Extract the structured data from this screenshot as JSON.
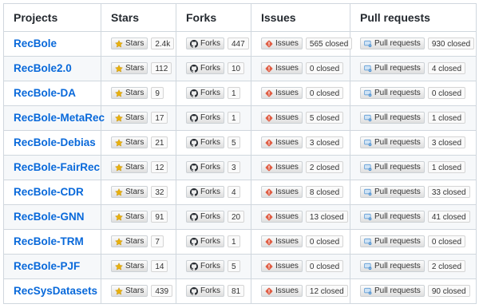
{
  "headers": {
    "projects": "Projects",
    "stars": "Stars",
    "forks": "Forks",
    "issues": "Issues",
    "pull_requests": "Pull requests"
  },
  "badge_labels": {
    "stars": "Stars",
    "forks": "Forks",
    "issues": "Issues",
    "pull_requests": "Pull requests"
  },
  "icons": {
    "stars": "star-icon",
    "forks": "github-octocat-icon",
    "issues": "issue-diamond-icon",
    "pull_requests": "pull-request-icon"
  },
  "colors": {
    "link": "#0969da",
    "star": "#e8b10e",
    "issue": "#e05d44",
    "pull_request": "#4a8fd0"
  },
  "rows": [
    {
      "project": "RecBole",
      "stars": "2.4k",
      "forks": "447",
      "issues": "565 closed",
      "pulls": "930 closed"
    },
    {
      "project": "RecBole2.0",
      "stars": "112",
      "forks": "10",
      "issues": "0 closed",
      "pulls": "4 closed"
    },
    {
      "project": "RecBole-DA",
      "stars": "9",
      "forks": "1",
      "issues": "0 closed",
      "pulls": "0 closed"
    },
    {
      "project": "RecBole-MetaRec",
      "stars": "17",
      "forks": "1",
      "issues": "5 closed",
      "pulls": "1 closed"
    },
    {
      "project": "RecBole-Debias",
      "stars": "21",
      "forks": "5",
      "issues": "3 closed",
      "pulls": "3 closed"
    },
    {
      "project": "RecBole-FairRec",
      "stars": "12",
      "forks": "3",
      "issues": "2 closed",
      "pulls": "1 closed"
    },
    {
      "project": "RecBole-CDR",
      "stars": "32",
      "forks": "4",
      "issues": "8 closed",
      "pulls": "33 closed"
    },
    {
      "project": "RecBole-GNN",
      "stars": "91",
      "forks": "20",
      "issues": "13 closed",
      "pulls": "41 closed"
    },
    {
      "project": "RecBole-TRM",
      "stars": "7",
      "forks": "1",
      "issues": "0 closed",
      "pulls": "0 closed"
    },
    {
      "project": "RecBole-PJF",
      "stars": "14",
      "forks": "5",
      "issues": "0 closed",
      "pulls": "2 closed"
    },
    {
      "project": "RecSysDatasets",
      "stars": "439",
      "forks": "81",
      "issues": "12 closed",
      "pulls": "90 closed"
    }
  ]
}
